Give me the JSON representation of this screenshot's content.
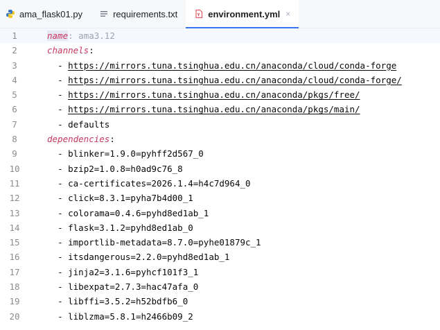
{
  "tabs": [
    {
      "label": "ama_flask01.py",
      "icon": "python-file-icon"
    },
    {
      "label": "requirements.txt",
      "icon": "text-file-icon"
    },
    {
      "label": "environment.yml",
      "icon": "yaml-file-icon",
      "active": true
    }
  ],
  "close_glyph": "×",
  "colors": {
    "accent": "#3574f0",
    "key": "#c7375f"
  },
  "lines": {
    "l1": {
      "no": "1",
      "key": "name",
      "sep": ": ",
      "value": "ama3.12"
    },
    "l2": {
      "no": "2",
      "key": "channels",
      "sep": ":"
    },
    "l3": {
      "no": "3",
      "dash": "- ",
      "url": "https://mirrors.tuna.tsinghua.edu.cn/anaconda/cloud/conda-forge"
    },
    "l4": {
      "no": "4",
      "dash": "- ",
      "url": "https://mirrors.tuna.tsinghua.edu.cn/anaconda/cloud/conda-forge/"
    },
    "l5": {
      "no": "5",
      "dash": "- ",
      "url": "https://mirrors.tuna.tsinghua.edu.cn/anaconda/pkgs/free/"
    },
    "l6": {
      "no": "6",
      "dash": "- ",
      "url": "https://mirrors.tuna.tsinghua.edu.cn/anaconda/pkgs/main/"
    },
    "l7": {
      "no": "7",
      "dash": "- ",
      "value": "defaults"
    },
    "l8": {
      "no": "8",
      "key": "dependencies",
      "sep": ":"
    },
    "l9": {
      "no": "9",
      "dash": "- ",
      "value": "blinker=1.9.0=pyhff2d567_0"
    },
    "l10": {
      "no": "10",
      "dash": "- ",
      "value": "bzip2=1.0.8=h0ad9c76_8"
    },
    "l11": {
      "no": "11",
      "dash": "- ",
      "value": "ca-certificates=2026.1.4=h4c7d964_0"
    },
    "l12": {
      "no": "12",
      "dash": "- ",
      "value": "click=8.3.1=pyha7b4d00_1"
    },
    "l13": {
      "no": "13",
      "dash": "- ",
      "value": "colorama=0.4.6=pyhd8ed1ab_1"
    },
    "l14": {
      "no": "14",
      "dash": "- ",
      "value": "flask=3.1.2=pyhd8ed1ab_0"
    },
    "l15": {
      "no": "15",
      "dash": "- ",
      "value": "importlib-metadata=8.7.0=pyhe01879c_1"
    },
    "l16": {
      "no": "16",
      "dash": "- ",
      "value": "itsdangerous=2.2.0=pyhd8ed1ab_1"
    },
    "l17": {
      "no": "17",
      "dash": "- ",
      "value": "jinja2=3.1.6=pyhcf101f3_1"
    },
    "l18": {
      "no": "18",
      "dash": "- ",
      "value": "libexpat=2.7.3=hac47afa_0"
    },
    "l19": {
      "no": "19",
      "dash": "- ",
      "value": "libffi=3.5.2=h52bdfb6_0"
    },
    "l20": {
      "no": "20",
      "dash": "- ",
      "value": "liblzma=5.8.1=h2466b09_2"
    }
  }
}
